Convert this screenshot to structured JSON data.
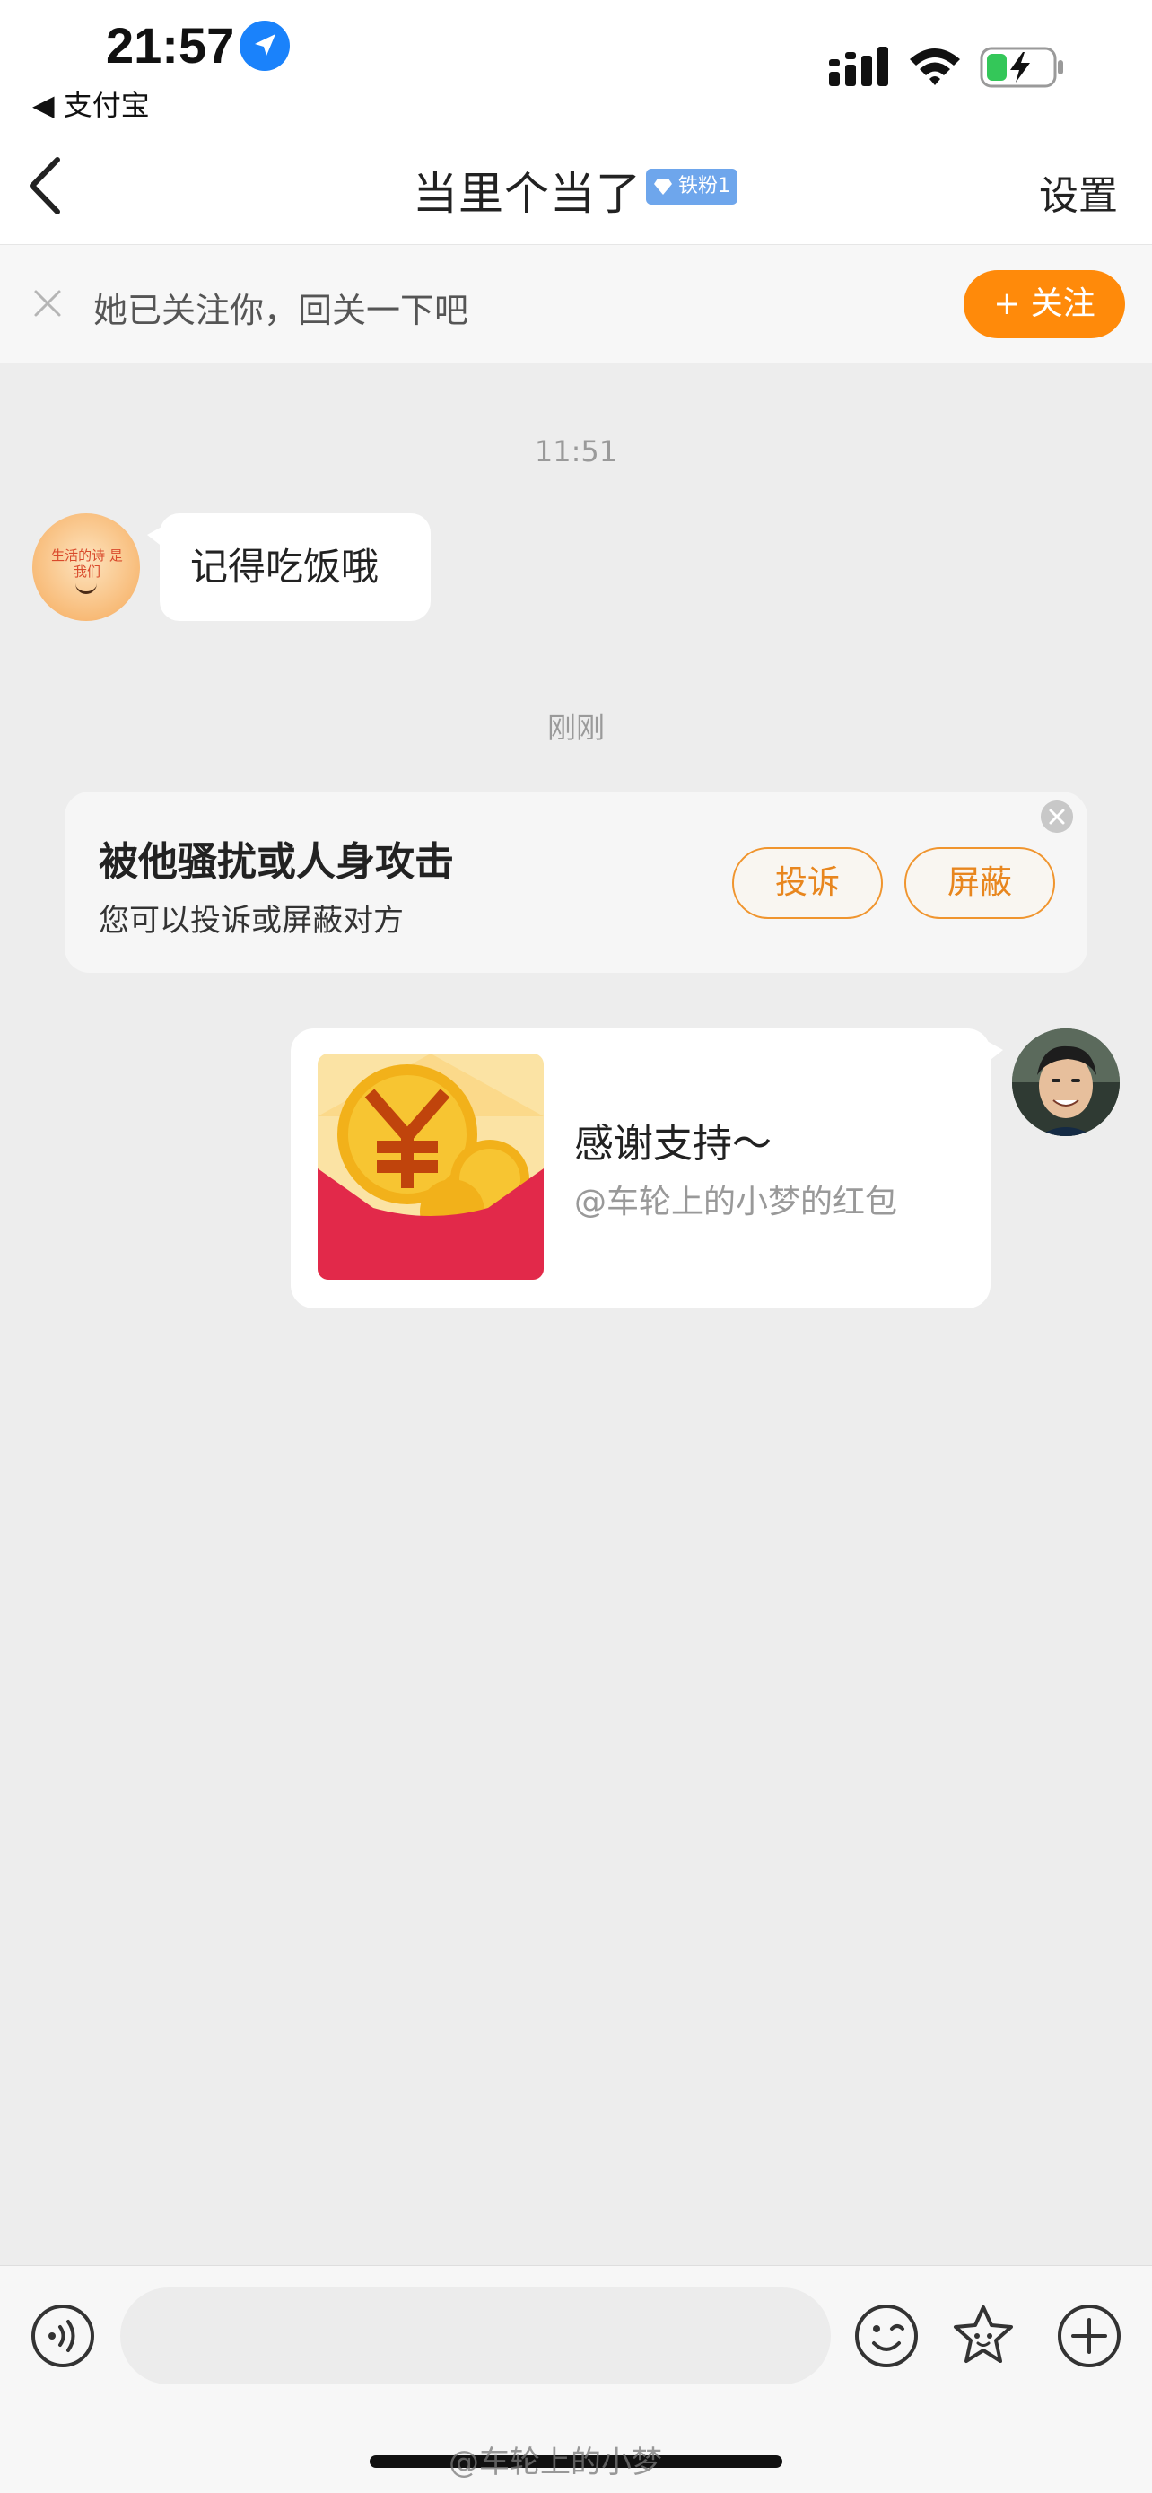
{
  "status_bar": {
    "time": "21:57",
    "back_app": "◀ 支付宝"
  },
  "nav": {
    "title": "当里个当了",
    "badge": "铁粉1",
    "settings": "设置"
  },
  "follow_banner": {
    "text": "她已关注你，回关一下吧",
    "button": "+ 关注"
  },
  "chat": {
    "timestamps": [
      "11:51",
      "刚刚"
    ],
    "received_message": "记得吃饭哦",
    "received_avatar_text": "生活的诗 是我们",
    "harassment_card": {
      "title": "被他骚扰或人身攻击",
      "subtitle": "您可以投诉或屏蔽对方",
      "report_button": "投诉",
      "block_button": "屏蔽"
    },
    "red_packet": {
      "title": "感谢支持～",
      "subtitle": "@车轮上的小梦的红包"
    }
  },
  "input_bar": {
    "placeholder": ""
  },
  "watermark": "@车轮上的小梦",
  "colors": {
    "accent_orange": "#ff8a0a",
    "badge_blue": "#6ea6ec",
    "red_packet": "#e2294a",
    "background": "#ededed"
  }
}
